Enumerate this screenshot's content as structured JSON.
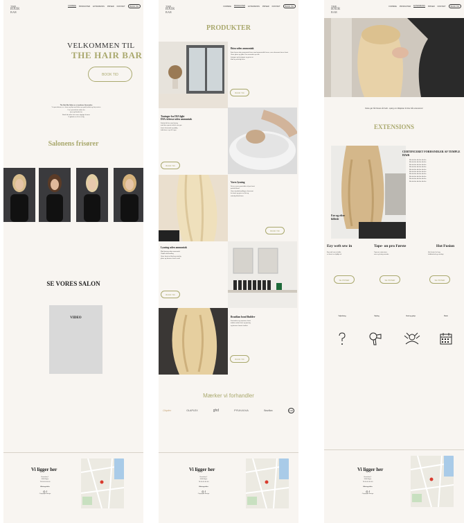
{
  "common": {
    "logo": [
      "THE",
      "HAIR",
      "BAR"
    ],
    "nav": [
      "FORSIDE",
      "PRODUKTER",
      "EXTENSIONS",
      "PRISER",
      "KONTAKT",
      "BOOK TID"
    ]
  },
  "home": {
    "welcome": "VELKOMMEN TIL",
    "brand": "THE HAIR BAR",
    "book_button": "BOOK TID",
    "intro_bold": "The Hair Bar Salon er et moderne frisørsalon",
    "intro_lines": [
      "Vi specialiserer os i farve og klip med fokus på god kvalitet og høj service",
      "Vi er specialister inden for",
      "lyse og blonde hår",
      "Book tid online hos vores dygtige frisører",
      "Vi glæder os til at se dig"
    ],
    "stylists_heading": "Salonens frisører",
    "see_salon": "SE VORES SALON",
    "video_label": "VIDEO"
  },
  "products": {
    "heading": "PRODUKTER",
    "book_label": "BOOK TID",
    "items": [
      {
        "title": "Ibiza uden ammoniak",
        "body": [
          "Ibiza farver uden ammoniak farve med ammoniakfri farver, som skånsomt farver håret",
          "Giver glans og fylde. Kan anvendes på alle",
          "hårtyper og farvetyper og giver en",
          "blød og naturlig farve."
        ]
      },
      {
        "title": "Toninger fra DIA light",
        "sub": "DIA richesse uden ammoniak",
        "body": [
          "Forkæl dit hår med toning",
          "med den nyeste teknik som gør",
          "håret skinnende og fyldig",
          "hold farve i op til 6 uger"
        ]
      },
      {
        "title": "Vores lysning",
        "body": [
          "Det er vores specialitet at lyse håret",
          "perfekt blond",
          "Vores lysebehandlinger skånsomt",
          "for håret og giver en flot og",
          "naturlig blond farve"
        ]
      },
      {
        "title": "Lysning uden ammoniak",
        "body": [
          "Med lysning uden ammoniak",
          "Olaplex behandling",
          "Giver håret en blød og naturlig",
          "glans og bevarer håret sundt"
        ]
      },
      {
        "title": "Brazilian bond Builder",
        "body": [
          "Forstærker og reparerer håret",
          "indefra under farve og lysning",
          "og bevarer hårets kvalitet"
        ]
      }
    ],
    "brands_heading": "Mærker vi forhandler",
    "brands": [
      "Olaplex",
      "OLAPLEX",
      "ghd",
      "PRAVANA",
      "Brazilian",
      "K18"
    ]
  },
  "extensions": {
    "tagline": "Dette gør hår flowet så hvidt - spørg om tilføjelser til dine hår extensions!",
    "heading": "EXTENSIONS",
    "certified": "CERTIFICERET FORHANDLER AF TEMPLE HAIR",
    "certified_body": [
      "Bla bla bla bla bla bla bla",
      "Bla bla bla bla bla bla bla",
      "Bla bla bla bla bla bla bla",
      "Bla bla bla bla bla bla bla",
      "Bla bla bla bla bla bla bla",
      "Bla bla bla bla bla bla bla",
      "Bla bla bla bla bla bla bla",
      "Bla bla bla bla bla bla bla",
      "Bla bla bla bla bla bla bla",
      "Bla bla bla bla bla bla bla"
    ],
    "before_after": "Før og efter billede",
    "methods": [
      {
        "title": "Ezy weft sew in",
        "body": [
          "Ezy weft sew in fylde",
          "så håret ser fyldigt ud"
        ],
        "btn": "SE PRISER"
      },
      {
        "title": "Tape- on pro Første",
        "body": [
          "Tape-on extensions",
          "nem og hurtig metode"
        ],
        "btn": "SE PRISER"
      },
      {
        "title": "Hot Fusion",
        "body": [
          "Hot fusion for lang",
          "holdbarhed og naturligt"
        ],
        "btn": "SE PRISER"
      }
    ],
    "features": [
      "Vejledning",
      "Styling",
      "Vask og pleje",
      "Book"
    ]
  },
  "footer": {
    "heading": "Vi ligger her",
    "lines": [
      "Hovedvej 1",
      "0000 Byen",
      "Tlf 00 00 00 00",
      "Åbningstider"
    ],
    "copyright": "Copyright design"
  },
  "colors": {
    "olive": "#a9a86d",
    "bg": "#f8f5f1",
    "photo_dark": "#2d2d30"
  }
}
